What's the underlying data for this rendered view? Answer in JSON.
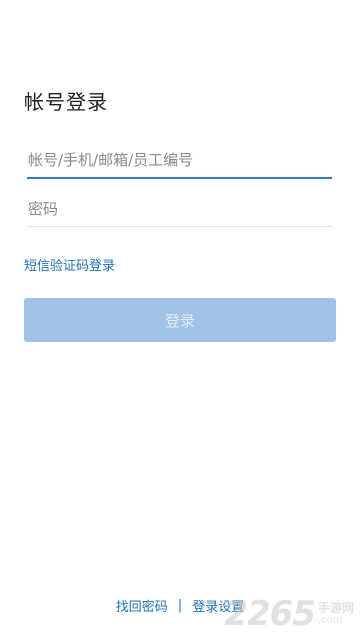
{
  "title": "帐号登录",
  "account": {
    "placeholder": "帐号/手机/邮箱/员工编号",
    "value": ""
  },
  "password": {
    "placeholder": "密码",
    "value": ""
  },
  "sms_login": "短信验证码登录",
  "login_button": "登录",
  "footer": {
    "recover_password": "找回密码",
    "separator": "|",
    "login_settings": "登录设置"
  },
  "watermark": {
    "number": "2265",
    "name": "手游网",
    "domain": ".com"
  },
  "colors": {
    "accent": "#2f7ec9",
    "link": "#1f6fb8",
    "button_disabled_bg": "#9fc2e6",
    "button_text": "#e4eefa"
  }
}
